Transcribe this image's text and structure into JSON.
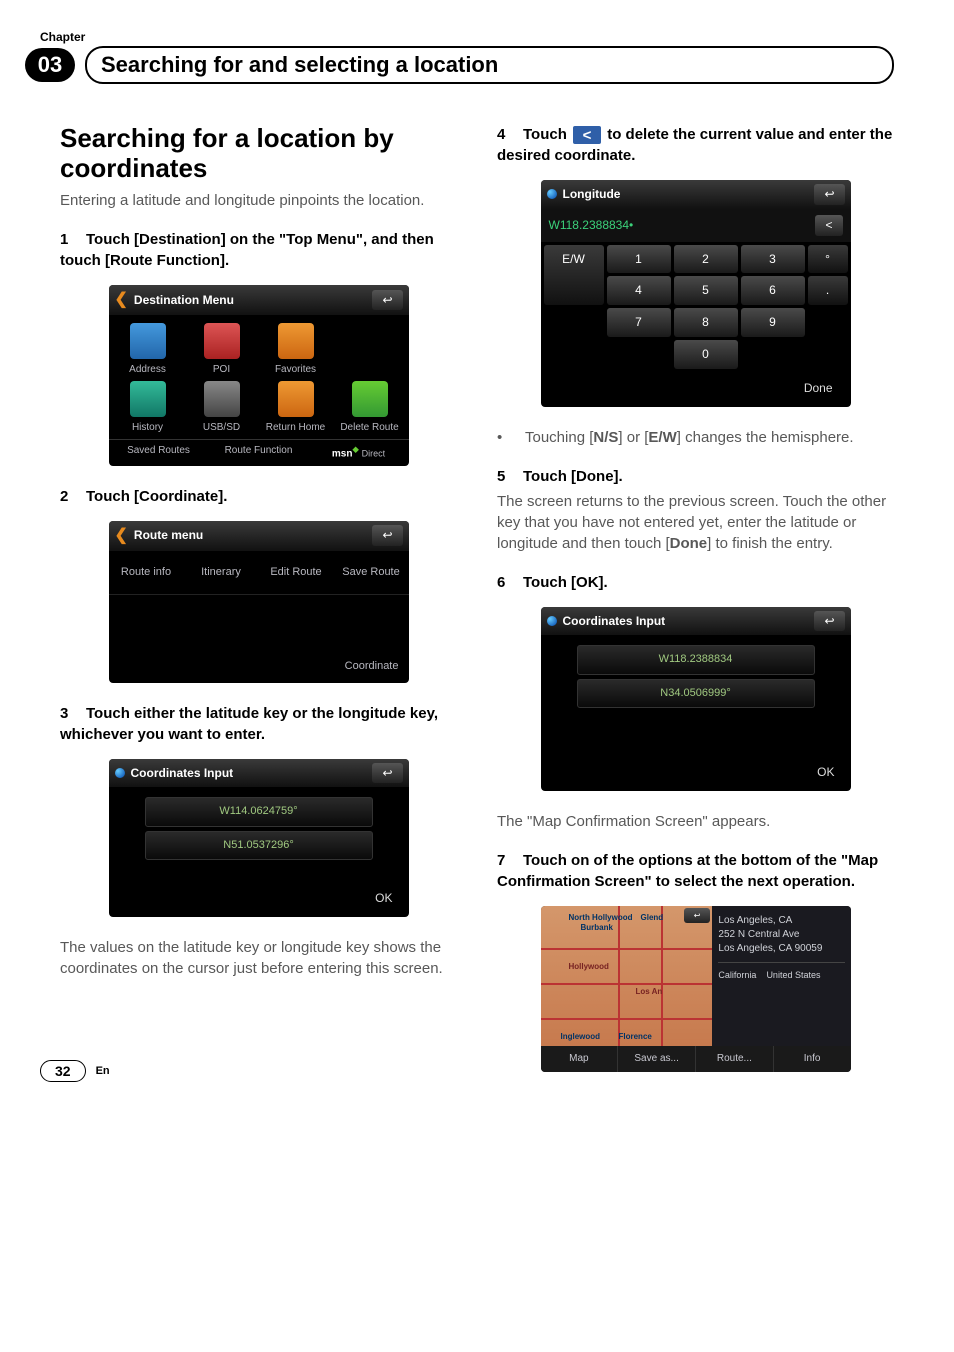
{
  "chapter_label": "Chapter",
  "chapter_number": "03",
  "chapter_title": "Searching for and selecting a location",
  "section_title": "Searching for a location by coordinates",
  "intro": "Entering a latitude and longitude pinpoints the location.",
  "step1": "Touch [Destination] on the \"Top Menu\", and then touch [Route Function].",
  "step2": "Touch [Coordinate].",
  "step3": "Touch either the latitude key or the longitude key, whichever you want to enter.",
  "step3_after": "The values on the latitude key or longitude key shows the coordinates on the cursor just before entering this screen.",
  "step4_prefix": "Touch ",
  "step4_suffix": " to delete the current value and enter the desired coordinate.",
  "step4_bullet_prefix": "Touching [",
  "step4_bullet_ns": "N/S",
  "step4_bullet_mid": "] or [",
  "step4_bullet_ew": "E/W",
  "step4_bullet_suffix": "] changes the hemisphere.",
  "step5": "Touch [Done].",
  "step5_after_1": "The screen returns to the previous screen. Touch the other key that you have not entered yet, enter the latitude or longitude and then touch [",
  "step5_after_bold": "Done",
  "step5_after_2": "] to finish the entry.",
  "step6": "Touch [OK].",
  "step6_after": "The \"Map Confirmation Screen\" appears.",
  "step7": "Touch on of the options at the bottom of the \"Map Confirmation Screen\" to select the next operation.",
  "page_number": "32",
  "lang": "En",
  "dev1": {
    "title": "Destination Menu",
    "items": [
      "Address",
      "POI",
      "Favorites",
      "History",
      "USB/SD",
      "Return Home",
      "Delete Route"
    ],
    "bottom": [
      "Saved Routes",
      "Route Function"
    ],
    "msn": "msn",
    "msn_sub": "Direct"
  },
  "dev2": {
    "title": "Route menu",
    "items": [
      "Route info",
      "Itinerary",
      "Edit Route",
      "Save Route"
    ],
    "foot": "Coordinate"
  },
  "dev3": {
    "title": "Coordinates Input",
    "v1": "W114.0624759°",
    "v2": "N51.0537296°",
    "ok": "OK"
  },
  "dev4": {
    "title": "Longitude",
    "value": "W118.2388834•",
    "ew": "E/W",
    "keys": [
      "1",
      "2",
      "3",
      "°",
      "4",
      "5",
      "6",
      ".",
      "7",
      "8",
      "9",
      "",
      "",
      "0",
      "",
      ""
    ],
    "done": "Done",
    "backspace": "<"
  },
  "dev5": {
    "title": "Coordinates Input",
    "v1": "W118.2388834",
    "v2": "N34.0506999°",
    "ok": "OK"
  },
  "dev6": {
    "cities": [
      "North Hollywood",
      "Burbank",
      "Glend",
      "Hollywood",
      "Los An",
      "Inglewood",
      "Florence"
    ],
    "addr": [
      "Los Angeles, CA",
      "252 N Central Ave",
      "Los Angeles, CA 90059"
    ],
    "state": "California",
    "country": "United States",
    "buttons": [
      "Map",
      "Save as...",
      "Route...",
      "Info"
    ]
  }
}
